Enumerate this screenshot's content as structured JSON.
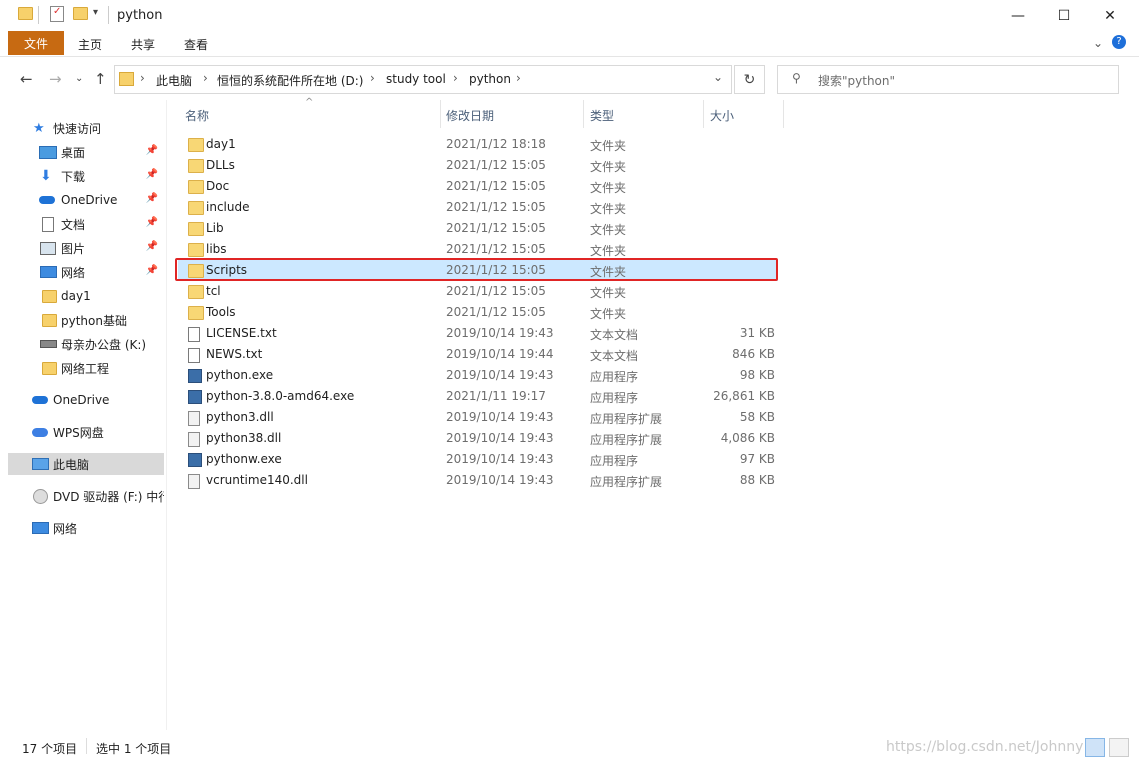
{
  "window": {
    "title": "python"
  },
  "ribbon": {
    "file_tab": "文件",
    "tabs": [
      "主页",
      "共享",
      "查看"
    ]
  },
  "address": {
    "crumbs": [
      "此电脑",
      "恒恒的系统配件所在地 (D:)",
      "study tool",
      "python"
    ],
    "search_placeholder": "搜索\"python\""
  },
  "sidebar": {
    "items": [
      {
        "label": "快速访问",
        "icon": "star-icon"
      },
      {
        "label": "桌面",
        "icon": "desktop-icon",
        "pinned": true
      },
      {
        "label": "下载",
        "icon": "download-icon",
        "pinned": true
      },
      {
        "label": "OneDrive",
        "icon": "cloud-icon",
        "pinned": true
      },
      {
        "label": "文档",
        "icon": "document-icon",
        "pinned": true
      },
      {
        "label": "图片",
        "icon": "picture-icon",
        "pinned": true
      },
      {
        "label": "网络",
        "icon": "network-icon",
        "pinned": true
      },
      {
        "label": "day1",
        "icon": "folder-icon"
      },
      {
        "label": "python基础",
        "icon": "folder-icon"
      },
      {
        "label": "母亲办公盘 (K:)",
        "icon": "drive-icon"
      },
      {
        "label": "网络工程",
        "icon": "folder-icon"
      },
      {
        "label": "OneDrive",
        "icon": "cloud-icon"
      },
      {
        "label": "WPS网盘",
        "icon": "cloud-icon"
      },
      {
        "label": "此电脑",
        "icon": "computer-icon",
        "selected": true
      },
      {
        "label": "DVD 驱动器 (F:) 中行",
        "icon": "dvd-icon"
      },
      {
        "label": "网络",
        "icon": "network-icon"
      }
    ]
  },
  "columns": {
    "name": "名称",
    "date": "修改日期",
    "type": "类型",
    "size": "大小"
  },
  "files": [
    {
      "name": "day1",
      "date": "2021/1/12 18:18",
      "type": "文件夹",
      "size": "",
      "icon": "folder"
    },
    {
      "name": "DLLs",
      "date": "2021/1/12 15:05",
      "type": "文件夹",
      "size": "",
      "icon": "folder"
    },
    {
      "name": "Doc",
      "date": "2021/1/12 15:05",
      "type": "文件夹",
      "size": "",
      "icon": "folder"
    },
    {
      "name": "include",
      "date": "2021/1/12 15:05",
      "type": "文件夹",
      "size": "",
      "icon": "folder"
    },
    {
      "name": "Lib",
      "date": "2021/1/12 15:05",
      "type": "文件夹",
      "size": "",
      "icon": "folder"
    },
    {
      "name": "libs",
      "date": "2021/1/12 15:05",
      "type": "文件夹",
      "size": "",
      "icon": "folder"
    },
    {
      "name": "Scripts",
      "date": "2021/1/12 15:05",
      "type": "文件夹",
      "size": "",
      "icon": "folder",
      "selected": true
    },
    {
      "name": "tcl",
      "date": "2021/1/12 15:05",
      "type": "文件夹",
      "size": "",
      "icon": "folder"
    },
    {
      "name": "Tools",
      "date": "2021/1/12 15:05",
      "type": "文件夹",
      "size": "",
      "icon": "folder"
    },
    {
      "name": "LICENSE.txt",
      "date": "2019/10/14 19:43",
      "type": "文本文档",
      "size": "31 KB",
      "icon": "doc"
    },
    {
      "name": "NEWS.txt",
      "date": "2019/10/14 19:44",
      "type": "文本文档",
      "size": "846 KB",
      "icon": "doc"
    },
    {
      "name": "python.exe",
      "date": "2019/10/14 19:43",
      "type": "应用程序",
      "size": "98 KB",
      "icon": "exe"
    },
    {
      "name": "python-3.8.0-amd64.exe",
      "date": "2021/1/11 19:17",
      "type": "应用程序",
      "size": "26,861 KB",
      "icon": "exe"
    },
    {
      "name": "python3.dll",
      "date": "2019/10/14 19:43",
      "type": "应用程序扩展",
      "size": "58 KB",
      "icon": "dll"
    },
    {
      "name": "python38.dll",
      "date": "2019/10/14 19:43",
      "type": "应用程序扩展",
      "size": "4,086 KB",
      "icon": "dll"
    },
    {
      "name": "pythonw.exe",
      "date": "2019/10/14 19:43",
      "type": "应用程序",
      "size": "97 KB",
      "icon": "exe"
    },
    {
      "name": "vcruntime140.dll",
      "date": "2019/10/14 19:43",
      "type": "应用程序扩展",
      "size": "88 KB",
      "icon": "dll"
    }
  ],
  "status": {
    "count": "17 个项目",
    "selection": "选中 1 个项目"
  },
  "watermark": "https://blog.csdn.net/Johnny"
}
